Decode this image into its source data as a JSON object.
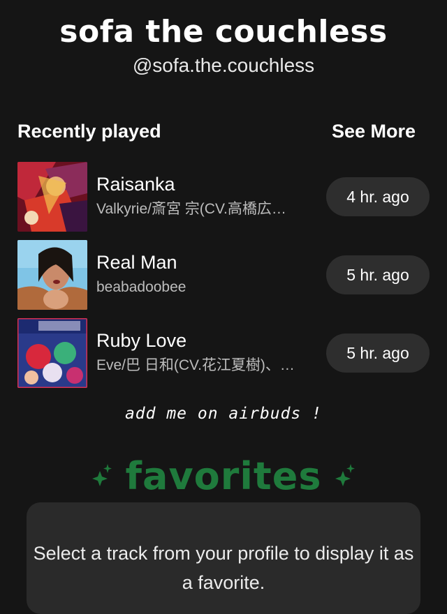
{
  "profile": {
    "display_name": "sofa the couchless",
    "handle": "@sofa.the.couchless"
  },
  "recently_played": {
    "title": "Recently played",
    "see_more_label": "See More",
    "tracks": [
      {
        "title": "Raisanka",
        "artist": "Valkyrie/斎宮 宗(CV.高橋広…",
        "time": "4 hr. ago"
      },
      {
        "title": "Real Man",
        "artist": "beabadoobee",
        "time": "5 hr. ago"
      },
      {
        "title": "Ruby Love",
        "artist": "Eve/巴 日和(CV.花江夏樹)、…",
        "time": "5 hr. ago"
      }
    ]
  },
  "tagline": "add me on airbuds !",
  "favorites": {
    "title": "favorites",
    "empty_message": "Select a track from your profile to display it as a favorite."
  },
  "colors": {
    "background": "#151515",
    "pill": "#2e2e2e",
    "favorites_green": "#1f7a3c",
    "card": "#2a2a2a"
  }
}
